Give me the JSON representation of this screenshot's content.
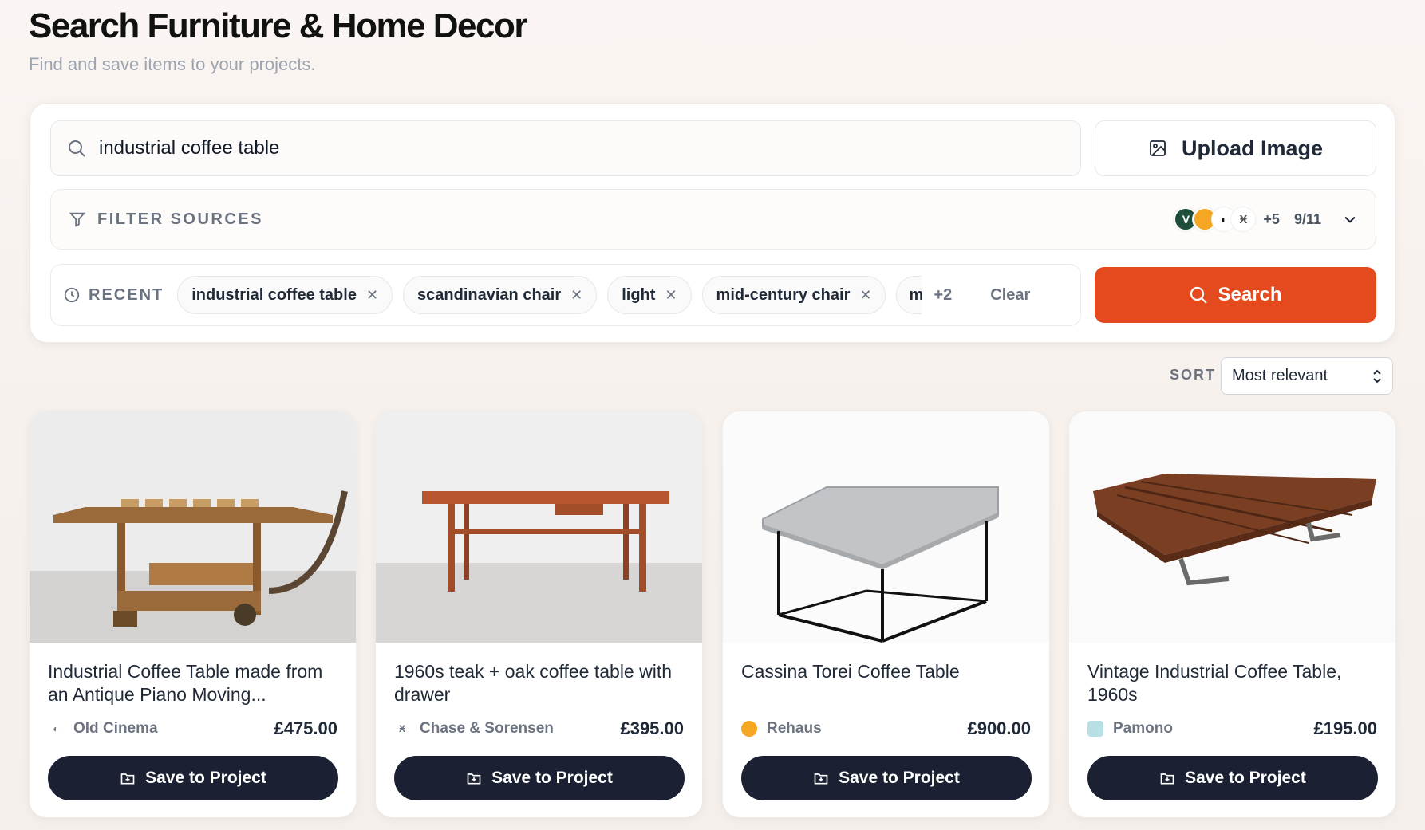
{
  "header": {
    "title": "Search Furniture & Home Decor",
    "subtitle": "Find and save items to your projects."
  },
  "search": {
    "query": "industrial coffee table",
    "upload_label": "Upload Image",
    "button_label": "Search"
  },
  "filters": {
    "label": "FILTER SOURCES",
    "source_icons": [
      {
        "name": "vinterior",
        "glyph": "V",
        "color": "#1e4d3a"
      },
      {
        "name": "rehaus",
        "glyph": "",
        "color": "#f5a623"
      },
      {
        "name": "old-cinema",
        "glyph": "◐",
        "color": "#111111"
      },
      {
        "name": "chase-sorensen",
        "glyph": "Ӿ",
        "color": "#555555"
      }
    ],
    "more_count": "+5",
    "selected_ratio": "9/11"
  },
  "recent": {
    "label": "RECENT",
    "chips": [
      "industrial coffee table",
      "scandinavian chair",
      "light",
      "mid-century chair"
    ],
    "cut_chip": "m",
    "overflow_count": "+2",
    "clear_label": "Clear"
  },
  "sort": {
    "label": "SORT",
    "selected": "Most relevant"
  },
  "products": [
    {
      "title": "Industrial Coffee Table made from an Antique Piano Moving...",
      "source": "Old Cinema",
      "price": "£475.00",
      "save_label": "Save to Project"
    },
    {
      "title": "1960s teak + oak coffee table with drawer",
      "source": "Chase & Sorensen",
      "price": "£395.00",
      "save_label": "Save to Project"
    },
    {
      "title": "Cassina Torei Coffee Table",
      "source": "Rehaus",
      "price": "£900.00",
      "save_label": "Save to Project"
    },
    {
      "title": "Vintage Industrial Coffee Table, 1960s",
      "source": "Pamono",
      "price": "£195.00",
      "save_label": "Save to Project"
    }
  ],
  "colors": {
    "accent": "#e54a1e",
    "dark_button": "#1b2132"
  }
}
